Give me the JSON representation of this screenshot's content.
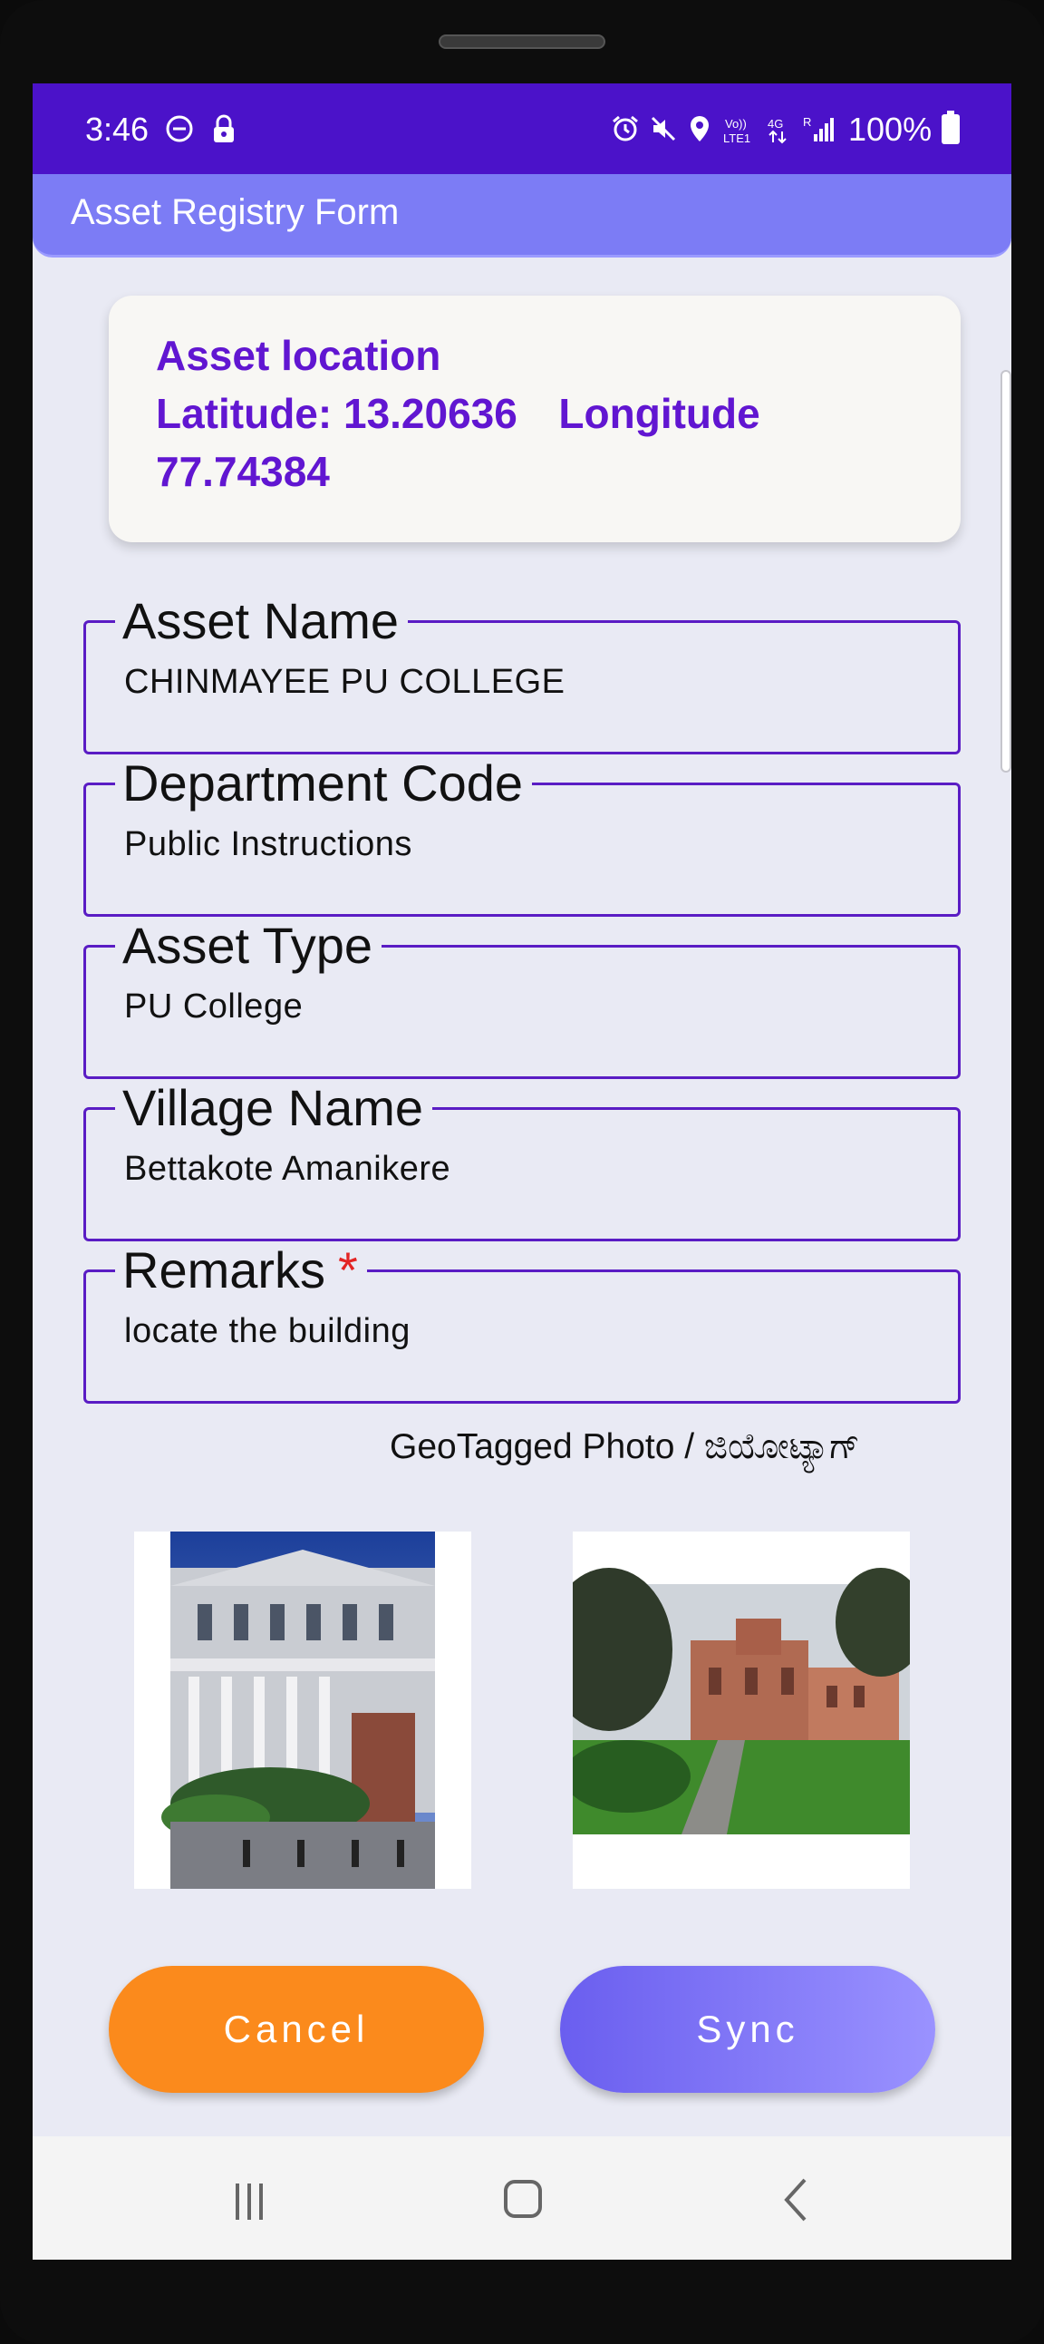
{
  "status_bar": {
    "time": "3:46",
    "battery": "100%",
    "icons": [
      "do-not-disturb-icon",
      "lock-icon",
      "alarm-icon",
      "mute-icon",
      "location-icon",
      "volte-icon",
      "network-4g-icon",
      "signal-icon",
      "battery-icon"
    ]
  },
  "app_bar": {
    "title": "Asset Registry Form"
  },
  "location_card": {
    "heading": "Asset location",
    "latitude_label": "Latitude:",
    "latitude": "13.20636",
    "longitude_label": "Longitude",
    "longitude": "77.74384"
  },
  "form": {
    "asset_name": {
      "label": "Asset Name",
      "value": "CHINMAYEE PU COLLEGE"
    },
    "department_code": {
      "label": "Department Code",
      "value": "Public Instructions"
    },
    "asset_type": {
      "label": "Asset Type",
      "value": "PU College"
    },
    "village_name": {
      "label": "Village Name",
      "value": "Bettakote Amanikere"
    },
    "remarks": {
      "label": "Remarks",
      "required_mark": "*",
      "value": "locate the building"
    }
  },
  "photos": {
    "label": "GeoTagged Photo / ಜಿಯೋಟ್ಯಾಗ್"
  },
  "buttons": {
    "cancel": "Cancel",
    "sync": "Sync"
  },
  "nav_bar": {
    "icons": [
      "recent-apps-icon",
      "home-icon",
      "back-icon"
    ]
  },
  "colors": {
    "status_bar": "#4b12c9",
    "app_bar": "#7c7cf5",
    "accent_text": "#6116d1",
    "field_border": "#5a1cc4",
    "cancel": "#fb8a1c",
    "sync_start": "#6a5eef",
    "sync_end": "#9a92ff",
    "required": "#e32424"
  }
}
